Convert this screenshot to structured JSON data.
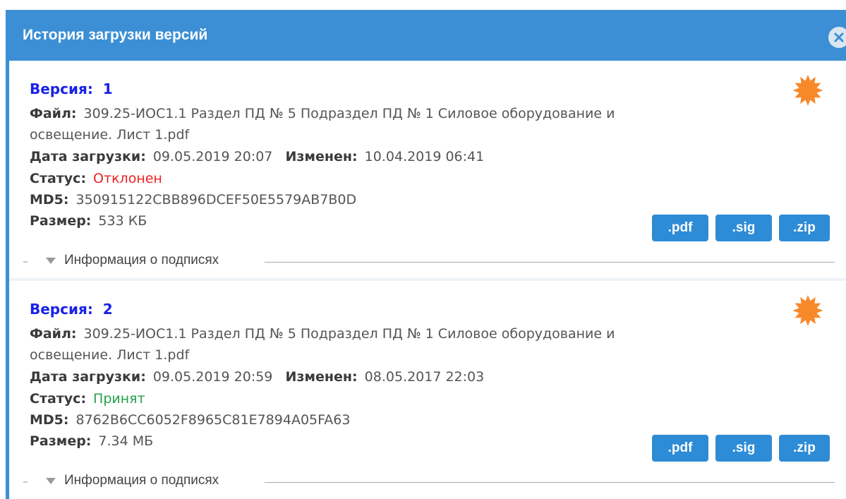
{
  "dialog": {
    "title": "История загрузки версий",
    "close_icon": "close-icon"
  },
  "labels": {
    "version": "Версия:",
    "file": "Файл:",
    "upload_date": "Дата загрузки:",
    "modified": "Изменен:",
    "status": "Статус:",
    "md5": "MD5:",
    "size": "Размер:"
  },
  "versions": [
    {
      "number": "1",
      "file_line1": "309.25-ИОС1.1 Раздел ПД № 5 Подраздел ПД № 1 Силовое оборудование и",
      "file_line2": "освещение. Лист 1.pdf",
      "upload_date": "09.05.2019 20:07",
      "modified": "10.04.2019 06:41",
      "status": "Отклонен",
      "md5": "350915122CBB896DCEF50E5579AB7B0D",
      "size": "533 КБ",
      "icon": "seal-icon",
      "buttons": {
        "pdf": ".pdf",
        "sig": ".sig",
        "zip": ".zip"
      },
      "signatures_label": "Информация о подписях"
    },
    {
      "number": "2",
      "file_line1": "309.25-ИОС1.1 Раздел ПД № 5 Подраздел ПД № 1 Силовое оборудование и",
      "file_line2": "освещение. Лист 1.pdf",
      "upload_date": "09.05.2019 20:59",
      "modified": "08.05.2017 22:03",
      "status": "Принят",
      "md5": "8762B6CC6052F8965C81E7894A05FA63",
      "size": "7.34 МБ",
      "icon": "seal-icon",
      "buttons": {
        "pdf": ".pdf",
        "sig": ".sig",
        "zip": ".zip"
      },
      "signatures_label": "Информация о подписях"
    }
  ],
  "colors": {
    "titlebar": "#3c8fd5",
    "version_heading": "#1a22e6",
    "status_rejected": "#ee2222",
    "status_accepted": "#22a04a",
    "button": "#2e8bd6",
    "seal": "#f7892b"
  }
}
